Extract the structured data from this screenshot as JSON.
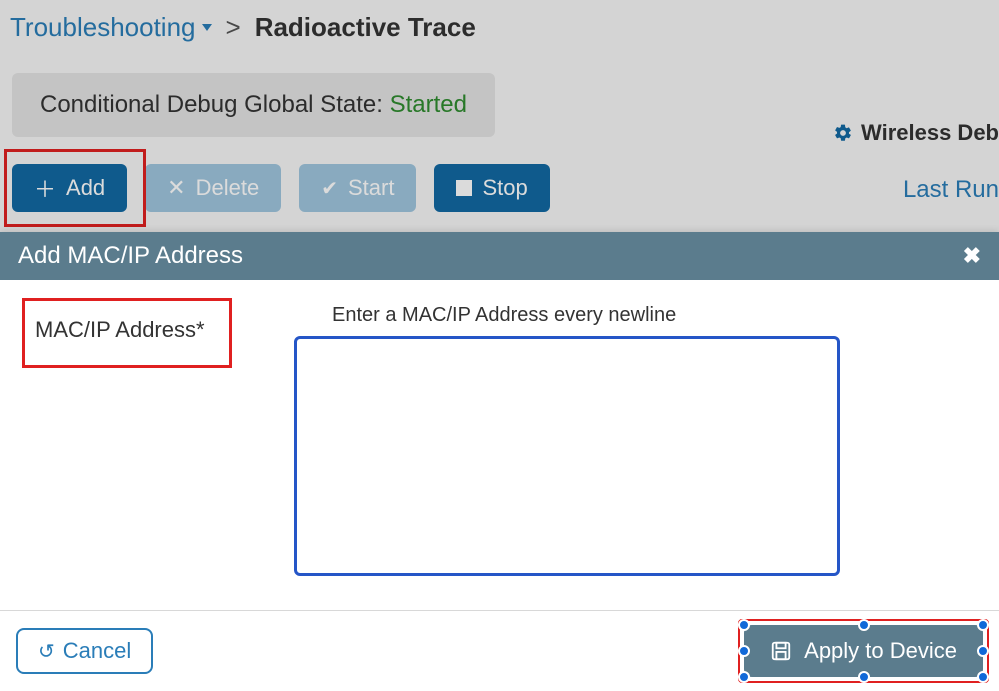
{
  "breadcrumb": {
    "root": "Troubleshooting",
    "current": "Radioactive Trace"
  },
  "status": {
    "label": "Conditional Debug Global State:",
    "value": "Started"
  },
  "toolbar": {
    "add": "Add",
    "delete": "Delete",
    "start": "Start",
    "stop": "Stop"
  },
  "right": {
    "wireless": "Wireless Deb",
    "last_run": "Last Run"
  },
  "modal": {
    "title": "Add MAC/IP Address",
    "field_label": "MAC/IP Address*",
    "helper": "Enter a MAC/IP Address every newline",
    "input_value": "",
    "cancel": "Cancel",
    "apply": "Apply to Device"
  },
  "icons": {
    "plus": "＋",
    "x": "✕",
    "check": "✔",
    "undo": "↺",
    "close": "✖",
    "chevron": ">"
  }
}
